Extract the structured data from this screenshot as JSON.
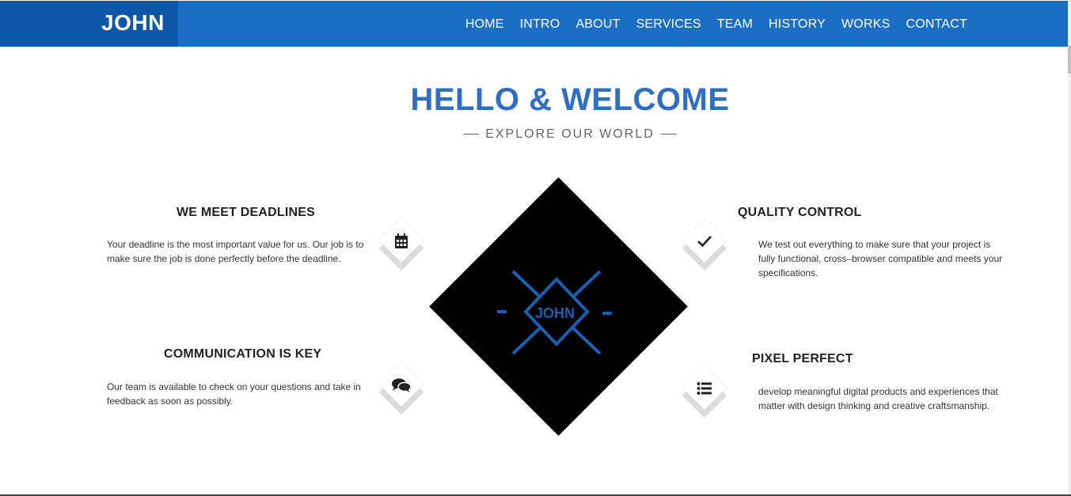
{
  "navbar": {
    "brand": "JOHN",
    "items": [
      "HOME",
      "INTRO",
      "ABOUT",
      "SERVICES",
      "TEAM",
      "HISTORY",
      "WORKS",
      "CONTACT"
    ]
  },
  "hero": {
    "title": "HELLO & WELCOME",
    "subtitle": "EXPLORE OUR WORLD"
  },
  "features": {
    "deadlines": {
      "title": "WE MEET DEADLINES",
      "text": "Your deadline is the most important value for us. Our job is to make sure the job is done perfectly before the deadline.",
      "icon": "calendar-icon"
    },
    "communication": {
      "title": "COMMUNICATION IS KEY",
      "text": "Our team is available to check on your questions and take in feedback as soon as possibly.",
      "icon": "comments-icon"
    },
    "quality": {
      "title": "QUALITY CONTROL",
      "text": "We test out everything to make sure that your project is fully functional, cross–browser compatible and meets your specifications.",
      "icon": "check-icon"
    },
    "pixel": {
      "title": "PIXEL PERFECT",
      "text": "develop meaningful digital products and experiences that matter with design thinking and creative craftsmanship.",
      "icon": "list-icon"
    }
  },
  "logo": {
    "text": "JOHN"
  },
  "colors": {
    "primary": "#1a6fc4",
    "brand_bg": "#0e57a6",
    "title": "#2e6fc0"
  }
}
